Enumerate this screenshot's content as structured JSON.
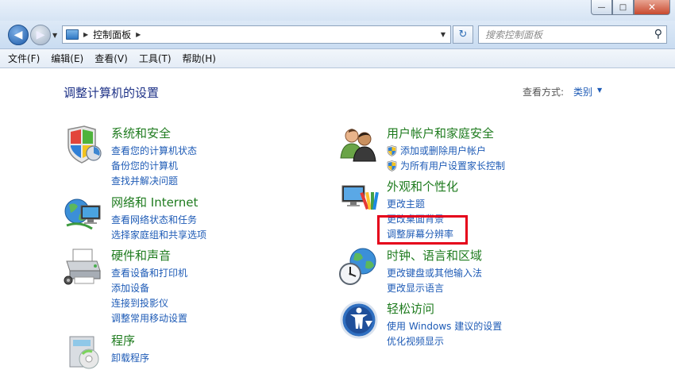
{
  "window": {
    "min_label": "—",
    "max_label": "□",
    "close_label": "✕"
  },
  "address": {
    "path": "控制面板",
    "search_placeholder": "搜索控制面板"
  },
  "menu": [
    "文件(F)",
    "编辑(E)",
    "查看(V)",
    "工具(T)",
    "帮助(H)"
  ],
  "page": {
    "title": "调整计算机的设置",
    "view_by_label": "查看方式:",
    "view_by_value": "类别"
  },
  "left_categories": [
    {
      "title": "系统和安全",
      "icon": "shield-icon",
      "links": [
        "查看您的计算机状态",
        "备份您的计算机",
        "查找并解决问题"
      ]
    },
    {
      "title": "网络和 Internet",
      "icon": "network-icon",
      "links": [
        "查看网络状态和任务",
        "选择家庭组和共享选项"
      ]
    },
    {
      "title": "硬件和声音",
      "icon": "printer-icon",
      "links": [
        "查看设备和打印机",
        "添加设备",
        "连接到投影仪",
        "调整常用移动设置"
      ]
    },
    {
      "title": "程序",
      "icon": "programs-icon",
      "links": [
        "卸载程序"
      ]
    }
  ],
  "right_categories": [
    {
      "title": "用户帐户和家庭安全",
      "icon": "users-icon",
      "links": [
        "添加或删除用户帐户",
        "为所有用户设置家长控制"
      ]
    },
    {
      "title": "外观和个性化",
      "icon": "appearance-icon",
      "links": [
        "更改主题",
        "更改桌面背景",
        "调整屏幕分辨率"
      ]
    },
    {
      "title": "时钟、语言和区域",
      "icon": "clock-globe-icon",
      "links": [
        "更改键盘或其他输入法",
        "更改显示语言"
      ]
    },
    {
      "title": "轻松访问",
      "icon": "accessibility-icon",
      "links": [
        "使用 Windows 建议的设置",
        "优化视频显示"
      ]
    }
  ],
  "colors": {
    "link": "#1e5bb6",
    "category_title": "#1e7b1e",
    "page_title": "#1e3287",
    "highlight": "#e5001a"
  }
}
